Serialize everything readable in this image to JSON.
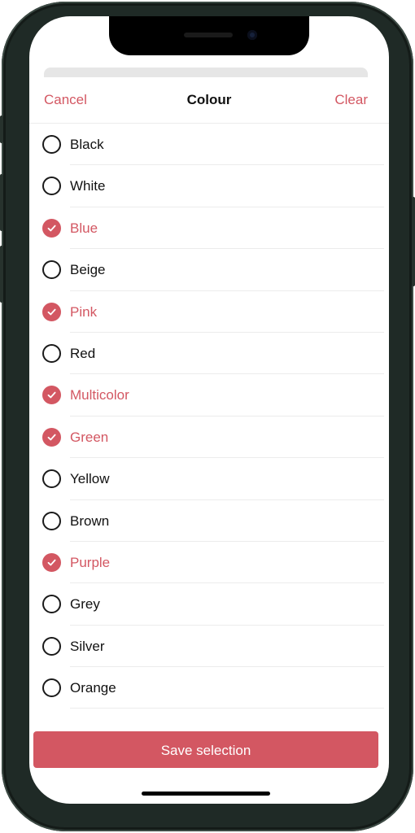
{
  "header": {
    "cancel_label": "Cancel",
    "title": "Colour",
    "clear_label": "Clear"
  },
  "colours": [
    {
      "label": "Black",
      "checked": false
    },
    {
      "label": "White",
      "checked": false
    },
    {
      "label": "Blue",
      "checked": true
    },
    {
      "label": "Beige",
      "checked": false
    },
    {
      "label": "Pink",
      "checked": true
    },
    {
      "label": "Red",
      "checked": false
    },
    {
      "label": "Multicolor",
      "checked": true
    },
    {
      "label": "Green",
      "checked": true
    },
    {
      "label": "Yellow",
      "checked": false
    },
    {
      "label": "Brown",
      "checked": false
    },
    {
      "label": "Purple",
      "checked": true
    },
    {
      "label": "Grey",
      "checked": false
    },
    {
      "label": "Silver",
      "checked": false
    },
    {
      "label": "Orange",
      "checked": false
    }
  ],
  "footer": {
    "save_label": "Save selection"
  },
  "theme": {
    "accent": "#d35762",
    "text": "#111111",
    "divider": "#ececec"
  }
}
